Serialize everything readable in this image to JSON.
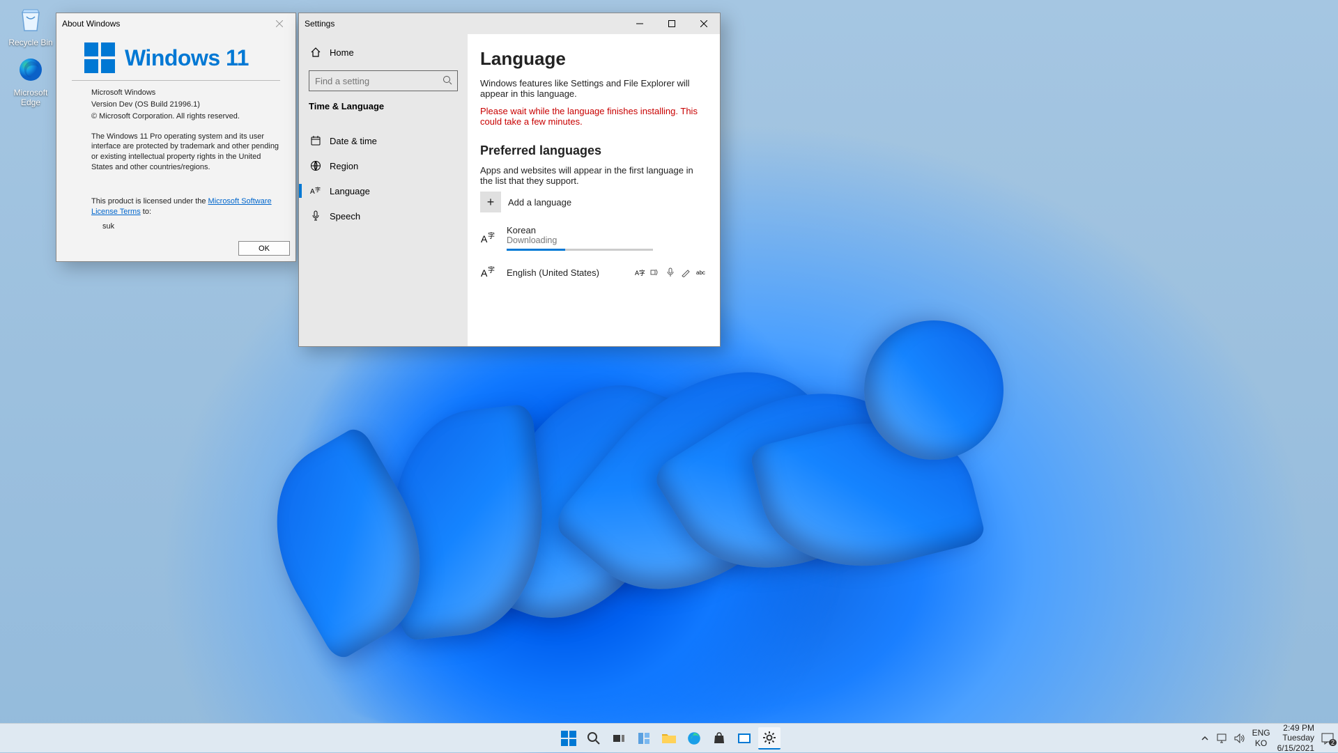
{
  "desktop": {
    "icons": [
      {
        "label": "Recycle Bin"
      },
      {
        "label": "Microsoft Edge"
      }
    ]
  },
  "about": {
    "title": "About Windows",
    "brand": "Windows 11",
    "line1": "Microsoft Windows",
    "line2": "Version Dev (OS Build 21996.1)",
    "line3": "© Microsoft Corporation. All rights reserved.",
    "para": "The Windows 11 Pro operating system and its user interface are protected by trademark and other pending or existing intellectual property rights in the United States and other countries/regions.",
    "lic_pre": "This product is licensed under the ",
    "lic_link": "Microsoft Software License Terms",
    "lic_post": " to:",
    "user": "suk",
    "ok": "OK"
  },
  "settings": {
    "title": "Settings",
    "home": "Home",
    "search_placeholder": "Find a setting",
    "category": "Time & Language",
    "items": {
      "date": "Date & time",
      "region": "Region",
      "language": "Language",
      "speech": "Speech"
    },
    "main": {
      "h1": "Language",
      "p1": "Windows features like Settings and File Explorer will appear in this language.",
      "warn": "Please wait while the language finishes installing. This could take a few minutes.",
      "h2": "Preferred languages",
      "p2": "Apps and websites will appear in the first language in the list that they support.",
      "add": "Add a language",
      "lang1": {
        "name": "Korean",
        "status": "Downloading"
      },
      "lang2": {
        "name": "English (United States)"
      }
    }
  },
  "taskbar": {
    "lang1": "ENG",
    "lang2": "KO",
    "time": "2:49 PM",
    "day": "Tuesday",
    "date": "6/15/2021",
    "notif": "2"
  }
}
